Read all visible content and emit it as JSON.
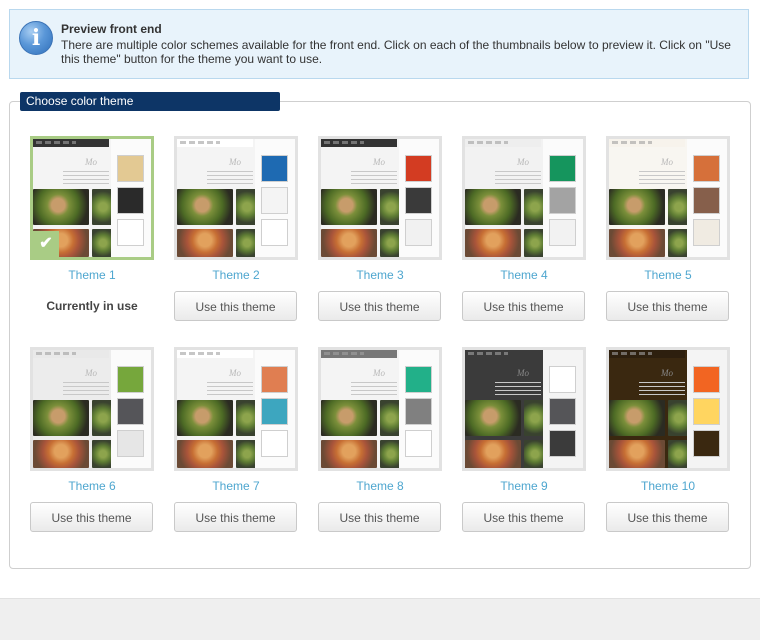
{
  "notice": {
    "title": "Preview front end",
    "text": "There are multiple color schemes available for the front end. Click on each of the thumbnails below to preview it. Click on \"Use this theme\" button for the theme you want to use.",
    "icon": "info-icon",
    "menu_text": "Mo"
  },
  "panel": {
    "heading": "Choose color theme"
  },
  "themes": [
    {
      "label": "Theme 1",
      "status": "Currently in use",
      "active": true,
      "bar": "#333333",
      "bg": "#f4f4f4",
      "swatches": [
        "#e3c993",
        "#2a2a2a",
        "#ffffff"
      ],
      "dark": false
    },
    {
      "label": "Theme 2",
      "button": "Use this theme",
      "active": false,
      "bar": "#ffffff",
      "bg": "#f4f4f4",
      "swatches": [
        "#1e6ab2",
        "#f4f4f4",
        "#ffffff"
      ],
      "dark": false
    },
    {
      "label": "Theme 3",
      "button": "Use this theme",
      "active": false,
      "bar": "#333333",
      "bg": "#f4f4f4",
      "swatches": [
        "#d33c22",
        "#3a3a3a",
        "#f1f1f1"
      ],
      "dark": false
    },
    {
      "label": "Theme 4",
      "button": "Use this theme",
      "active": false,
      "bar": "#eeeeee",
      "bg": "#f2f2f2",
      "swatches": [
        "#15955d",
        "#a3a3a3",
        "#f2f2f2"
      ],
      "dark": false
    },
    {
      "label": "Theme 5",
      "button": "Use this theme",
      "active": false,
      "bar": "#f7f3ec",
      "bg": "#f8f6f1",
      "swatches": [
        "#d6703a",
        "#865f4b",
        "#f0ebe2"
      ],
      "dark": false
    },
    {
      "label": "Theme 6",
      "button": "Use this theme",
      "active": false,
      "bar": "#e9e9e9",
      "bg": "#ececec",
      "swatches": [
        "#76a73c",
        "#555559",
        "#e6e6e6"
      ],
      "dark": false
    },
    {
      "label": "Theme 7",
      "button": "Use this theme",
      "active": false,
      "bar": "#ffffff",
      "bg": "#f4f4f4",
      "swatches": [
        "#e07e51",
        "#3da6bf",
        "#ffffff"
      ],
      "dark": false
    },
    {
      "label": "Theme 8",
      "button": "Use this theme",
      "active": false,
      "bar": "#777777",
      "bg": "#f4f4f4",
      "swatches": [
        "#22b089",
        "#808080",
        "#ffffff"
      ],
      "dark": false
    },
    {
      "label": "Theme 9",
      "button": "Use this theme",
      "active": false,
      "bar": "#3b3b3b",
      "bg": "#3b3b3b",
      "swatches": [
        "#ffffff",
        "#555558",
        "#3b3b3b"
      ],
      "dark": true
    },
    {
      "label": "Theme 10",
      "button": "Use this theme",
      "active": false,
      "bar": "#2d1f0e",
      "bg": "#3a2810",
      "swatches": [
        "#f26522",
        "#ffd560",
        "#3a2810"
      ],
      "dark": true
    }
  ]
}
